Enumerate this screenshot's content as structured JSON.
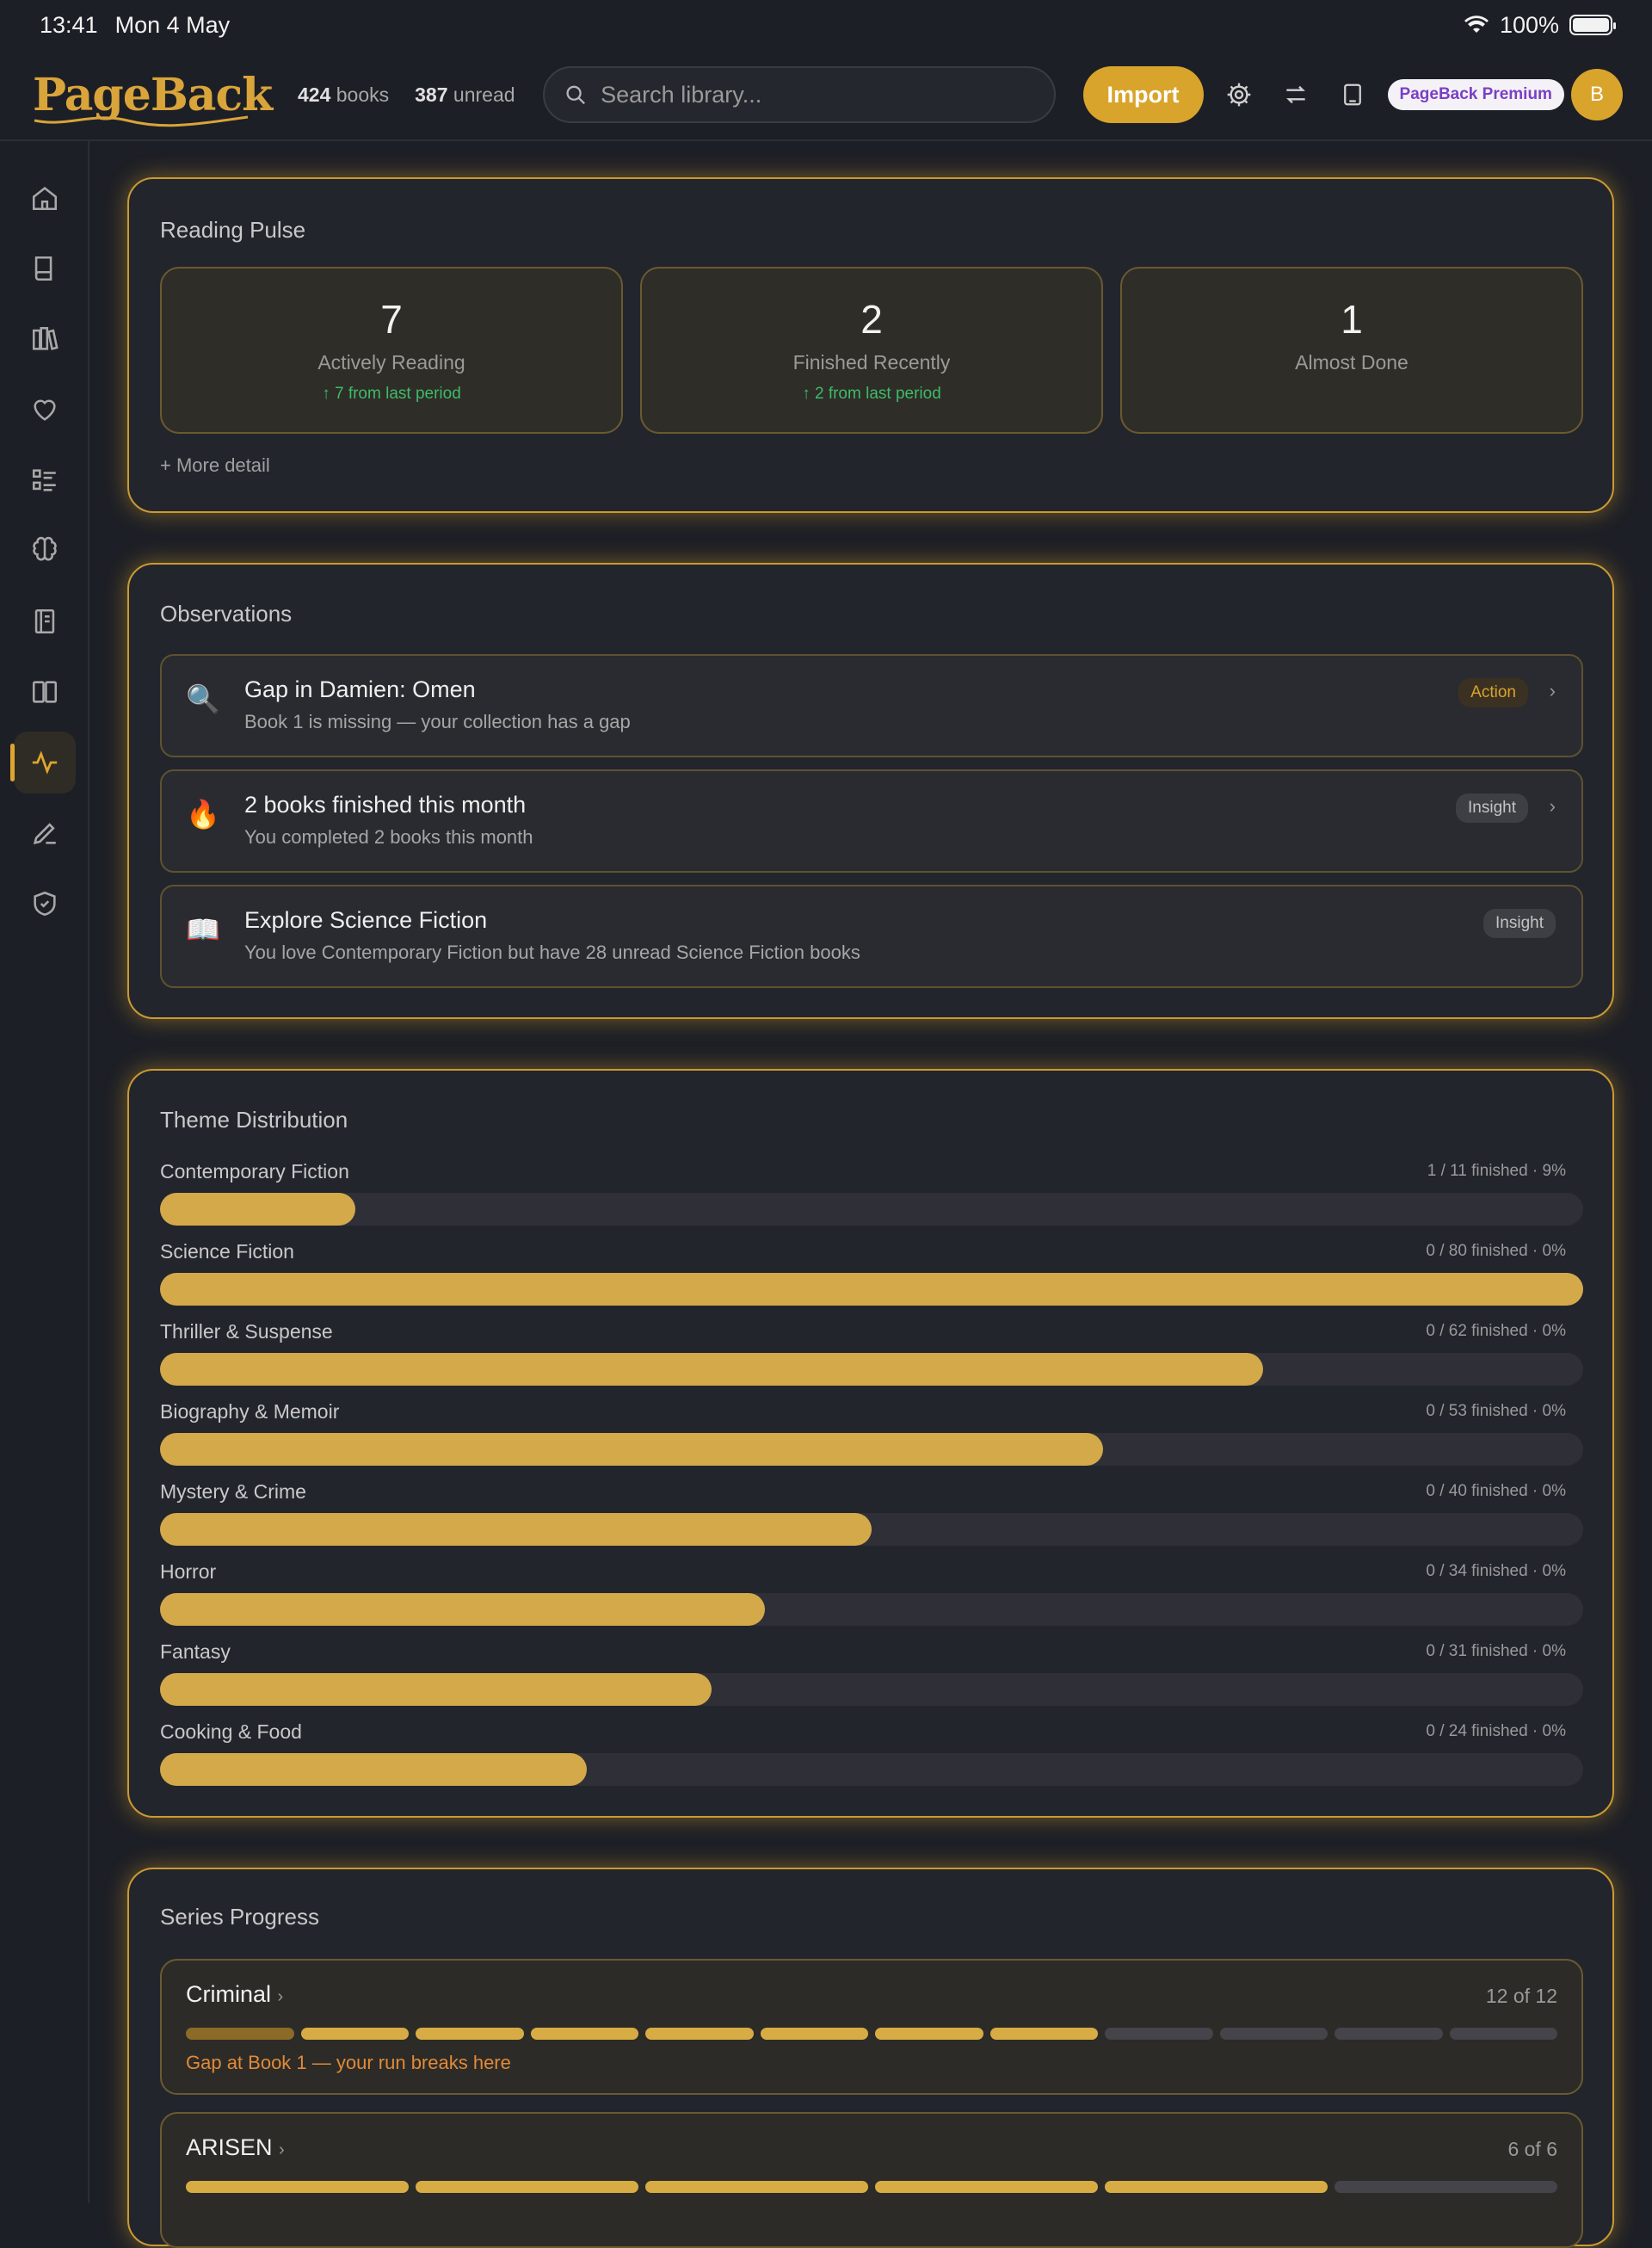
{
  "status": {
    "time": "13:41",
    "date": "Mon 4 May",
    "battery": "100%"
  },
  "header": {
    "logo": "PageBack",
    "books_count": "424",
    "books_label": "books",
    "unread_count": "387",
    "unread_label": "unread",
    "search_placeholder": "Search library...",
    "import_label": "Import",
    "premium_label": "PageBack Premium",
    "avatar_initial": "B"
  },
  "sidebar": {
    "items": [
      "home",
      "book",
      "library",
      "favorites",
      "lists",
      "brain",
      "notebook",
      "reader",
      "pulse",
      "write",
      "shield"
    ],
    "active": "pulse"
  },
  "reading_pulse": {
    "title": "Reading Pulse",
    "stats": [
      {
        "value": "7",
        "label": "Actively Reading",
        "change": "↑ 7 from last period"
      },
      {
        "value": "2",
        "label": "Finished Recently",
        "change": "↑ 2 from last period"
      },
      {
        "value": "1",
        "label": "Almost Done",
        "change": ""
      }
    ],
    "more": "+ More detail"
  },
  "observations": {
    "title": "Observations",
    "items": [
      {
        "icon": "🔍",
        "title": "Gap in Damien: Omen",
        "subtitle": "Book 1 is missing — your collection has a gap",
        "badge": "Action",
        "has_chevron": true
      },
      {
        "icon": "🔥",
        "title": "2 books finished this month",
        "subtitle": "You completed 2 books this month",
        "badge": "Insight",
        "has_chevron": true
      },
      {
        "icon": "📖",
        "title": "Explore Science Fiction",
        "subtitle": "You love Contemporary Fiction but have 28 unread Science Fiction books",
        "badge": "Insight",
        "has_chevron": false
      }
    ]
  },
  "theme_distribution": {
    "title": "Theme Distribution",
    "rows": [
      {
        "name": "Contemporary Fiction",
        "stat": "1 / 11 finished · 9%",
        "total": 11
      },
      {
        "name": "Science Fiction",
        "stat": "0 / 80 finished · 0%",
        "total": 80
      },
      {
        "name": "Thriller & Suspense",
        "stat": "0 / 62 finished · 0%",
        "total": 62
      },
      {
        "name": "Biography & Memoir",
        "stat": "0 / 53 finished · 0%",
        "total": 53
      },
      {
        "name": "Mystery & Crime",
        "stat": "0 / 40 finished · 0%",
        "total": 40
      },
      {
        "name": "Horror",
        "stat": "0 / 34 finished · 0%",
        "total": 34
      },
      {
        "name": "Fantasy",
        "stat": "0 / 31 finished · 0%",
        "total": 31
      },
      {
        "name": "Cooking & Food",
        "stat": "0 / 24 finished · 0%",
        "total": 24
      }
    ]
  },
  "series_progress": {
    "title": "Series Progress",
    "items": [
      {
        "name": "Criminal",
        "count": "12 of 12",
        "segments": 12,
        "owned": 7,
        "missing_first": true,
        "note": "Gap at Book 1 — your run breaks here"
      },
      {
        "name": "ARISEN",
        "count": "6 of 6",
        "segments": 6,
        "owned": 5,
        "missing_first": false,
        "note": ""
      }
    ]
  },
  "colors": {
    "accent": "#d9a42c",
    "bar": "#d4a94a",
    "positive": "#3dbb6b",
    "warning": "#e08a3a"
  }
}
